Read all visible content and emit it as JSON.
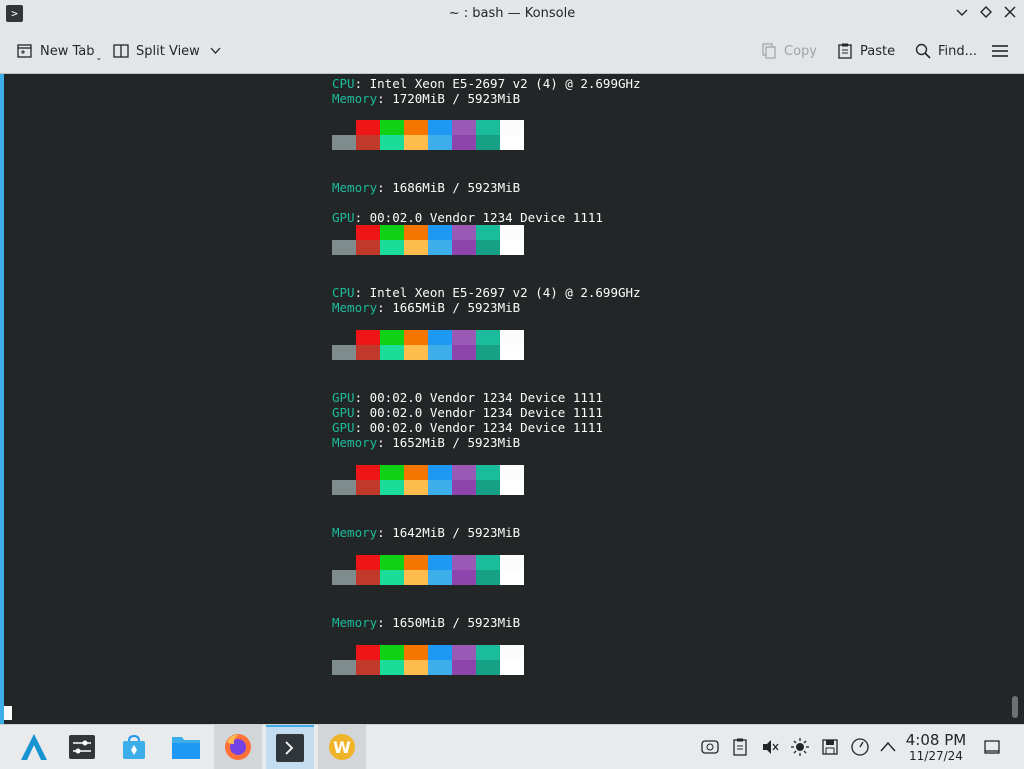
{
  "window": {
    "title": "~ : bash — Konsole"
  },
  "toolbar": {
    "new_tab": "New Tab",
    "split_view": "Split View",
    "copy": "Copy",
    "paste": "Paste",
    "find": "Find..."
  },
  "terminal": {
    "blocks": {
      "b1": {
        "cpu_key": "CPU",
        "cpu_val": ": Intel Xeon E5-2697 v2 (4) @ 2.699GHz",
        "mem_key": "Memory",
        "mem_val": ": 1720MiB / 5923MiB"
      },
      "b2": {
        "mem_key": "Memory",
        "mem_val": ": 1686MiB / 5923MiB",
        "gpu_key": "GPU",
        "gpu_val": ": 00:02.0 Vendor 1234 Device 1111"
      },
      "b3": {
        "cpu_key": "CPU",
        "cpu_val": ": Intel Xeon E5-2697 v2 (4) @ 2.699GHz",
        "mem_key": "Memory",
        "mem_val": ": 1665MiB / 5923MiB"
      },
      "b4": {
        "gpu_key": "GPU",
        "gpu_val": ": 00:02.0 Vendor 1234 Device 1111",
        "mem_key": "Memory",
        "mem_val": ": 1652MiB / 5923MiB"
      },
      "b5": {
        "mem_key": "Memory",
        "mem_val": ": 1642MiB / 5923MiB"
      },
      "b6": {
        "mem_key": "Memory",
        "mem_val": ": 1650MiB / 5923MiB"
      }
    },
    "palette_top": [
      "#232627",
      "#ed1515",
      "#11d116",
      "#f67400",
      "#1d99f3",
      "#9b59b6",
      "#1abc9c",
      "#fcfcfc"
    ],
    "palette_bottom": [
      "#7f8c8d",
      "#c0392b",
      "#1cdc9a",
      "#fdbc4b",
      "#3daee9",
      "#8e44ad",
      "#16a085",
      "#ffffff"
    ]
  },
  "taskbar": {
    "clock_time": "4:08 PM",
    "clock_date": "11/27/24"
  }
}
